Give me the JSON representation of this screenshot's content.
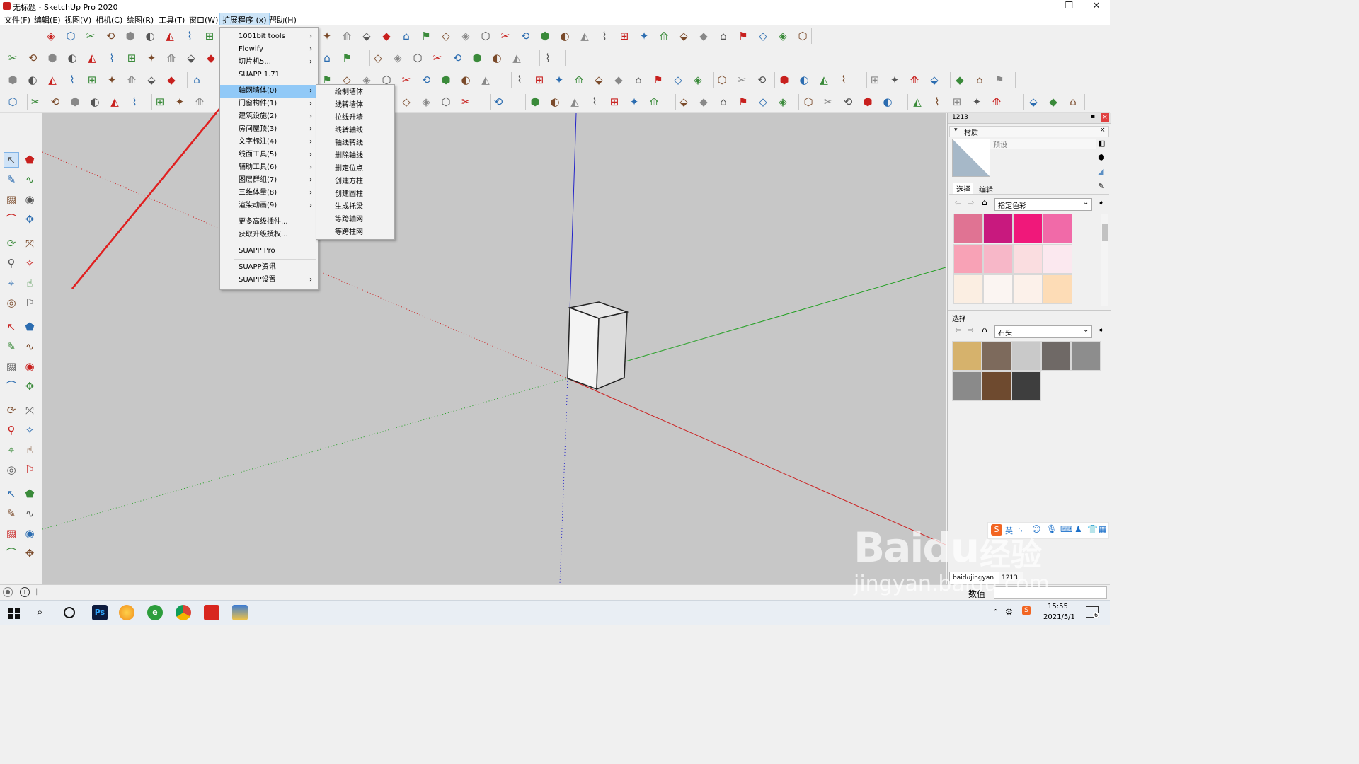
{
  "window": {
    "title": "无标题 - SketchUp Pro 2020",
    "min": "—",
    "max": "❐",
    "close": "✕"
  },
  "menubar": [
    {
      "label": "文件(F)",
      "id": "file"
    },
    {
      "label": "编辑(E)",
      "id": "edit"
    },
    {
      "label": "视图(V)",
      "id": "view"
    },
    {
      "label": "相机(C)",
      "id": "camera"
    },
    {
      "label": "绘图(R)",
      "id": "draw"
    },
    {
      "label": "工具(T)",
      "id": "tools"
    },
    {
      "label": "窗口(W)",
      "id": "window"
    },
    {
      "label": "扩展程序 (x)",
      "id": "extensions",
      "active": true
    },
    {
      "label": "帮助(H)",
      "id": "help"
    }
  ],
  "ext_menu": {
    "items": [
      {
        "label": "1001bit tools",
        "arrow": true
      },
      {
        "label": "Flowify",
        "arrow": true
      },
      {
        "label": "切片机5...",
        "arrow": true
      },
      {
        "label": "SUAPP 1.71",
        "arrow": false
      },
      {
        "divider": true
      },
      {
        "label": "轴网墙体(0)",
        "arrow": true,
        "highlight": true
      },
      {
        "label": "门窗构件(1)",
        "arrow": true
      },
      {
        "label": "建筑设施(2)",
        "arrow": true
      },
      {
        "label": "房间屋顶(3)",
        "arrow": true
      },
      {
        "label": "文字标注(4)",
        "arrow": true
      },
      {
        "label": "线面工具(5)",
        "arrow": true
      },
      {
        "label": "辅助工具(6)",
        "arrow": true
      },
      {
        "label": "图层群组(7)",
        "arrow": true
      },
      {
        "label": "三维体量(8)",
        "arrow": true
      },
      {
        "label": "渲染动画(9)",
        "arrow": true
      },
      {
        "divider": true
      },
      {
        "label": "更多高级插件...",
        "arrow": false
      },
      {
        "label": "获取升级授权...",
        "arrow": false
      },
      {
        "divider": true
      },
      {
        "label": "SUAPP Pro",
        "arrow": false
      },
      {
        "divider": true
      },
      {
        "label": "SUAPP资讯",
        "arrow": false
      },
      {
        "label": "SUAPP设置",
        "arrow": true
      }
    ],
    "arrow_glyph": "›"
  },
  "sub_menu": {
    "items": [
      "绘制墙体",
      "线转墙体",
      "拉线升墙",
      "线转轴线",
      "轴线转线",
      "删除轴线",
      "删定位点",
      "创建方柱",
      "创建圆柱",
      "生成托梁",
      "等跨轴网",
      "等跨柱网"
    ]
  },
  "right_panel": {
    "tray_title": "1213",
    "materials_title": "材质",
    "default_label": "预设",
    "tab_select": "选择",
    "tab_edit": "编辑",
    "collection_1": "指定色彩",
    "select_label": "选择",
    "collection_2": "石头",
    "swatches_1": [
      "#e07393",
      "#c8197e",
      "#f0187a",
      "#f16aa8",
      "#f8a2b6",
      "#f7b7c8",
      "#fadde0",
      "#fbe8ef",
      "#fbeee2",
      "#fbf5f2",
      "#fcf1ea",
      "#fddcb6"
    ],
    "swatches_2": [
      "#d6b26c",
      "#7d6a5c",
      "#c9c9c9",
      "#6f6966",
      "#8d8d8d",
      "#8a8a8a",
      "#6e4a2f",
      "#3e3e3e"
    ],
    "bottom_tab_1": "baidujingyan",
    "bottom_tab_2": "1213",
    "value_label": "数值"
  },
  "ime": {
    "lang": "英"
  },
  "taskbar": {
    "time": "15:55",
    "date": "2021/5/1",
    "notif": "6"
  },
  "watermark": {
    "brand": "Baidu",
    "cn": "经验",
    "url": "jingyan.baidu.com"
  },
  "colors": {
    "axis_red": "#cc2020",
    "axis_green": "#23a023",
    "axis_blue": "#2323c8",
    "highlight": "#91c9f7",
    "arrow": "#e02020"
  }
}
